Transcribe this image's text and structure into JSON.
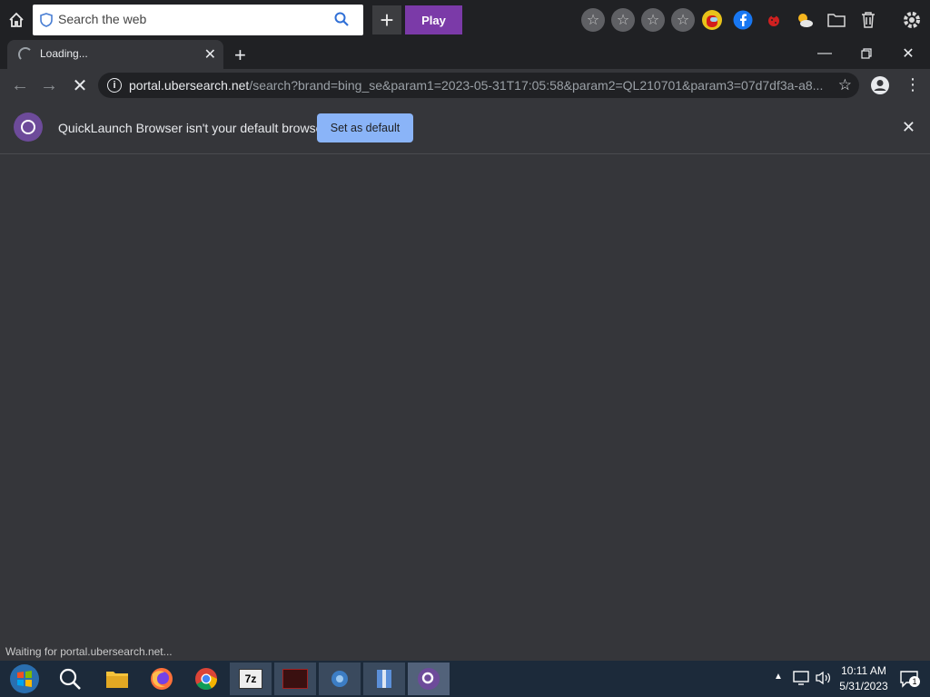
{
  "toolbar": {
    "search_placeholder": "Search the web",
    "play_label": "Play"
  },
  "tab": {
    "title": "Loading..."
  },
  "address": {
    "host": "portal.ubersearch.net",
    "path": "/search?brand=bing_se&param1=2023-05-31T17:05:58&param2=QL210701&param3=07d7df3a-a8..."
  },
  "infobar": {
    "message": "QuickLaunch Browser isn't your default browser",
    "button_label": "Set as default"
  },
  "status": {
    "text": "Waiting for portal.ubersearch.net..."
  },
  "taskbar": {
    "time": "10:11 AM",
    "date": "5/31/2023",
    "notification_count": "1",
    "icons": [
      "start-icon",
      "search-icon",
      "file-explorer-icon",
      "firefox-icon",
      "chrome-icon",
      "7zip-icon",
      "app-icon",
      "settings-icon",
      "archive-icon",
      "quicklaunch-icon"
    ]
  },
  "colors": {
    "accent_purple": "#7b3aa8",
    "button_blue": "#8ab4f8",
    "bg_dark": "#202124",
    "bg_panel": "#35363a"
  }
}
